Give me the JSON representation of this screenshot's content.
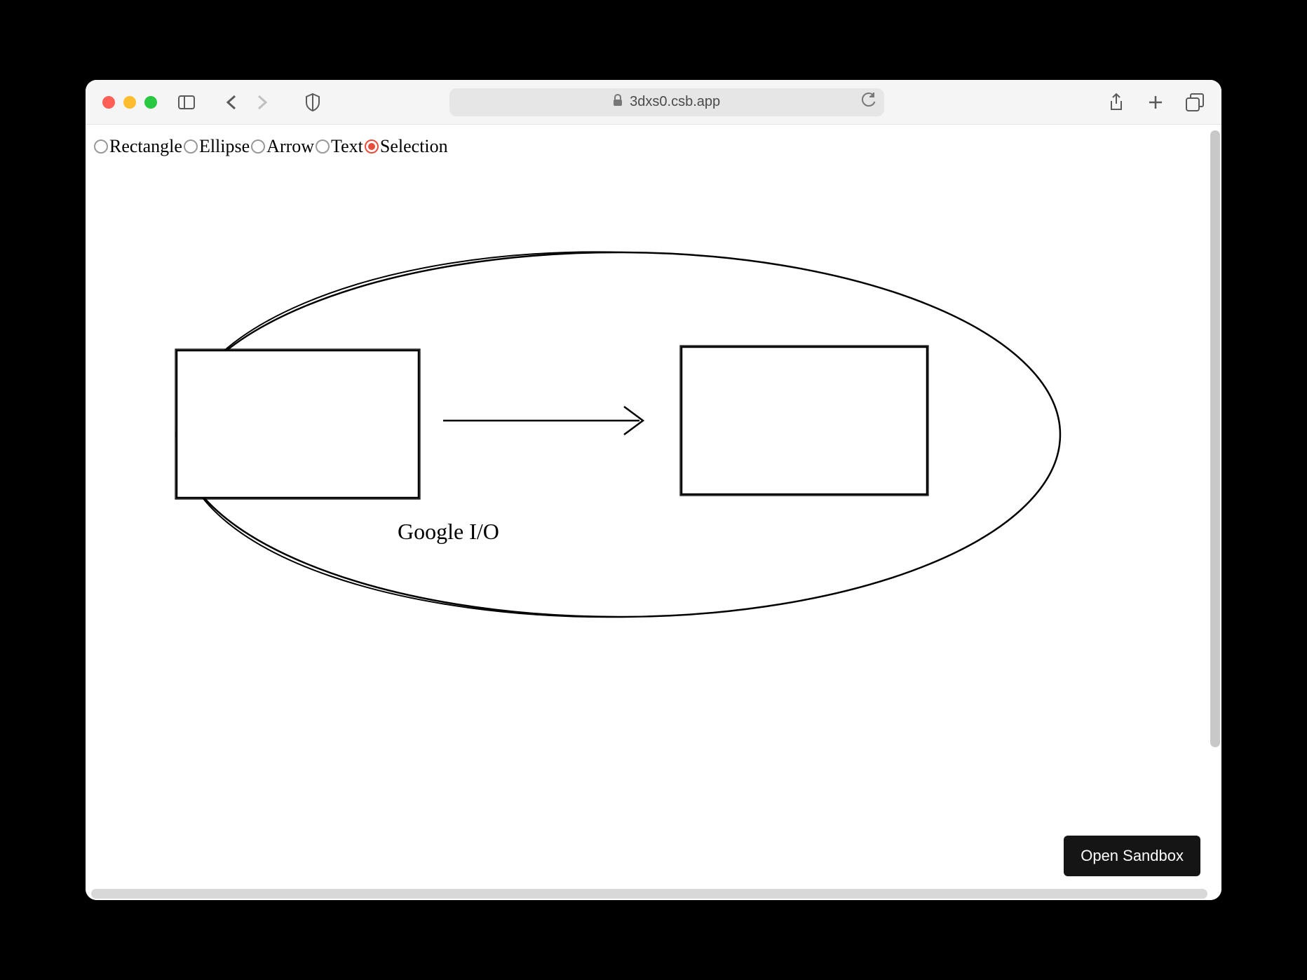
{
  "browser": {
    "url": "3dxs0.csb.app"
  },
  "toolbar": {
    "tools": [
      {
        "label": "Rectangle",
        "selected": false
      },
      {
        "label": "Ellipse",
        "selected": false
      },
      {
        "label": "Arrow",
        "selected": false
      },
      {
        "label": "Text",
        "selected": false
      },
      {
        "label": "Selection",
        "selected": true
      }
    ]
  },
  "canvas": {
    "text_label": "Google I/O"
  },
  "sandbox_button": "Open Sandbox"
}
